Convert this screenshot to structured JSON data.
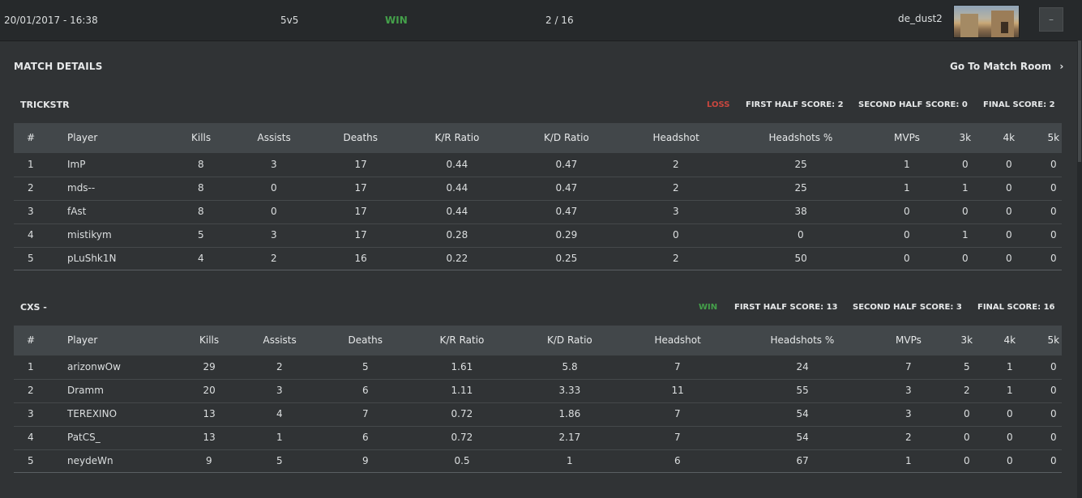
{
  "header": {
    "datetime": "20/01/2017 - 16:38",
    "mode": "5v5",
    "result": "WIN",
    "score": "2 / 16",
    "map": "de_dust2",
    "toggle_label": "–"
  },
  "section_title": "MATCH DETAILS",
  "match_room_label": "Go To Match Room",
  "columns": [
    "#",
    "Player",
    "Kills",
    "Assists",
    "Deaths",
    "K/R Ratio",
    "K/D Ratio",
    "Headshot",
    "Headshots %",
    "MVPs",
    "3k",
    "4k",
    "5k"
  ],
  "teams": [
    {
      "name": "TRICKSTR",
      "result": "LOSS",
      "first_half": "FIRST HALF SCORE: 2",
      "second_half": "SECOND HALF SCORE: 0",
      "final": "FINAL SCORE: 2",
      "rows": [
        [
          "1",
          "ImP",
          "8",
          "3",
          "17",
          "0.44",
          "0.47",
          "2",
          "25",
          "1",
          "0",
          "0",
          "0"
        ],
        [
          "2",
          "mds--",
          "8",
          "0",
          "17",
          "0.44",
          "0.47",
          "2",
          "25",
          "1",
          "1",
          "0",
          "0"
        ],
        [
          "3",
          "fAst",
          "8",
          "0",
          "17",
          "0.44",
          "0.47",
          "3",
          "38",
          "0",
          "0",
          "0",
          "0"
        ],
        [
          "4",
          "mistikym",
          "5",
          "3",
          "17",
          "0.28",
          "0.29",
          "0",
          "0",
          "0",
          "1",
          "0",
          "0"
        ],
        [
          "5",
          "pLuShk1N",
          "4",
          "2",
          "16",
          "0.22",
          "0.25",
          "2",
          "50",
          "0",
          "0",
          "0",
          "0"
        ]
      ]
    },
    {
      "name": "CXS -",
      "result": "WIN",
      "first_half": "FIRST HALF SCORE: 13",
      "second_half": "SECOND HALF SCORE: 3",
      "final": "FINAL SCORE: 16",
      "rows": [
        [
          "1",
          "arizonwOw",
          "29",
          "2",
          "5",
          "1.61",
          "5.8",
          "7",
          "24",
          "7",
          "5",
          "1",
          "0"
        ],
        [
          "2",
          "Dramm",
          "20",
          "3",
          "6",
          "1.11",
          "3.33",
          "11",
          "55",
          "3",
          "2",
          "1",
          "0"
        ],
        [
          "3",
          "TEREXINO",
          "13",
          "4",
          "7",
          "0.72",
          "1.86",
          "7",
          "54",
          "3",
          "0",
          "0",
          "0"
        ],
        [
          "4",
          "PatCS_",
          "13",
          "1",
          "6",
          "0.72",
          "2.17",
          "7",
          "54",
          "2",
          "0",
          "0",
          "0"
        ],
        [
          "5",
          "neydeWn",
          "9",
          "5",
          "9",
          "0.5",
          "1",
          "6",
          "67",
          "1",
          "0",
          "0",
          "0"
        ]
      ]
    }
  ]
}
